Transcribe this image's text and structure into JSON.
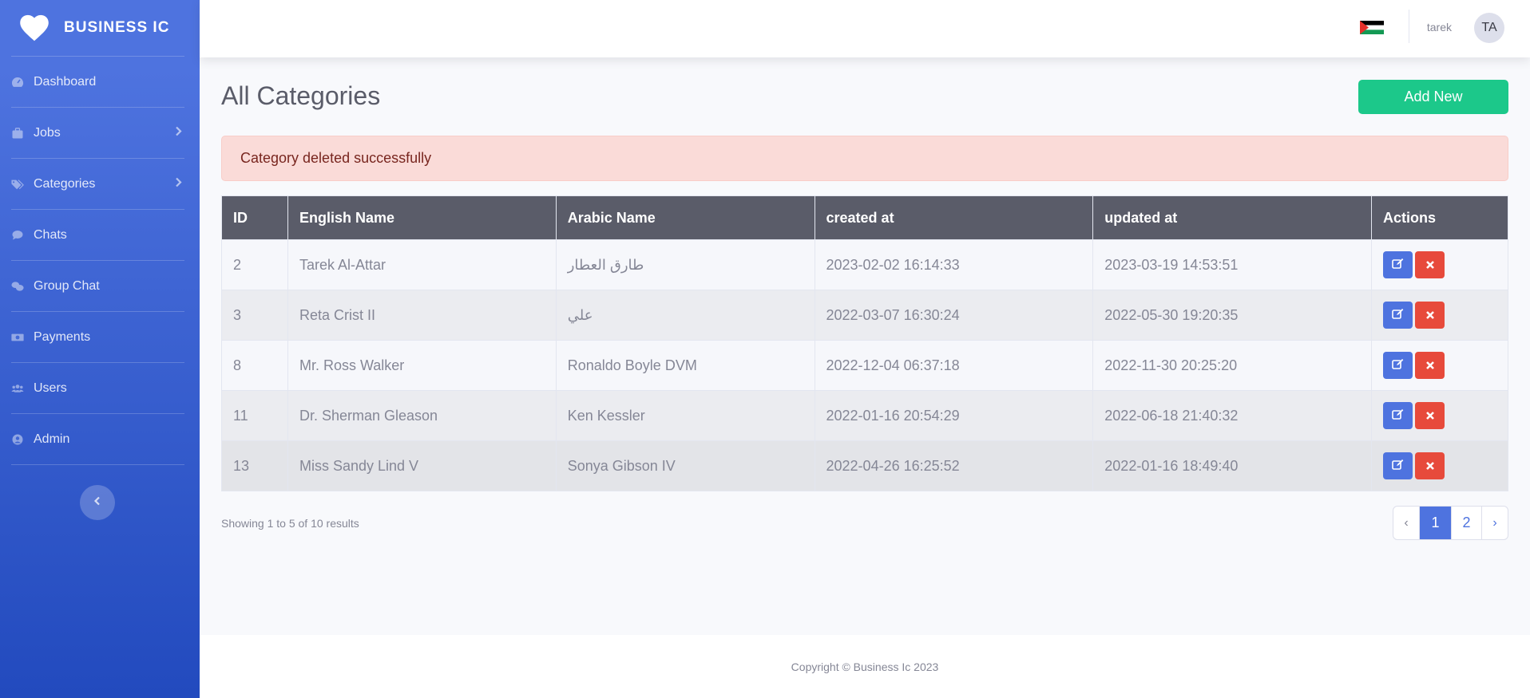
{
  "brand": {
    "name": "BUSINESS IC",
    "icon": "heart-icon"
  },
  "sidebar": {
    "items": [
      {
        "label": "Dashboard",
        "icon": "dashboard-gauge-icon"
      },
      {
        "label": "Jobs",
        "icon": "briefcase-icon",
        "has_submenu": true
      },
      {
        "label": "Categories",
        "icon": "tags-icon",
        "has_submenu": true
      },
      {
        "label": "Chats",
        "icon": "comment-icon"
      },
      {
        "label": "Group Chat",
        "icon": "comments-icon"
      },
      {
        "label": "Payments",
        "icon": "money-bill-icon"
      },
      {
        "label": "Users",
        "icon": "users-icon"
      },
      {
        "label": "Admin",
        "icon": "user-circle-icon"
      }
    ]
  },
  "topbar": {
    "language_flag": "palestine-flag",
    "username": "tarek",
    "avatar_initials": "TA"
  },
  "page": {
    "title": "All Categories",
    "add_button": "Add New"
  },
  "alert": {
    "message": "Category deleted successfully",
    "type": "danger"
  },
  "table": {
    "columns": [
      "ID",
      "English Name",
      "Arabic Name",
      "created at",
      "updated at",
      "Actions"
    ],
    "rows": [
      {
        "id": "2",
        "english_name": "Tarek Al-Attar",
        "arabic_name": "طارق العطار",
        "created_at": "2023-02-02 16:14:33",
        "updated_at": "2023-03-19 14:53:51"
      },
      {
        "id": "3",
        "english_name": "Reta Crist II",
        "arabic_name": "علي",
        "created_at": "2022-03-07 16:30:24",
        "updated_at": "2022-05-30 19:20:35"
      },
      {
        "id": "8",
        "english_name": "Mr. Ross Walker",
        "arabic_name": "Ronaldo Boyle DVM",
        "created_at": "2022-12-04 06:37:18",
        "updated_at": "2022-11-30 20:25:20"
      },
      {
        "id": "11",
        "english_name": "Dr. Sherman Gleason",
        "arabic_name": "Ken Kessler",
        "created_at": "2022-01-16 20:54:29",
        "updated_at": "2022-06-18 21:40:32"
      },
      {
        "id": "13",
        "english_name": "Miss Sandy Lind V",
        "arabic_name": "Sonya Gibson IV",
        "created_at": "2022-04-26 16:25:52",
        "updated_at": "2022-01-16 18:49:40"
      }
    ]
  },
  "pagination": {
    "summary": "Showing 1 to 5 of 10 results",
    "prev": "‹",
    "pages": [
      "1",
      "2"
    ],
    "current": "1",
    "next": "›"
  },
  "footer": {
    "copyright": "Copyright © Business Ic 2023"
  },
  "colors": {
    "sidebar_top": "#4e73df",
    "sidebar_bottom": "#224abe",
    "success": "#1cc88a",
    "danger": "#e74a3b",
    "primary": "#4e73df",
    "table_header": "#5a5c69"
  }
}
